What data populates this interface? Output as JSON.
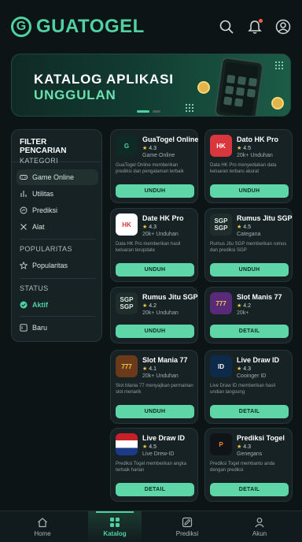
{
  "header": {
    "brand": "GUATOGEL",
    "icons": [
      "search-icon",
      "bell-icon",
      "user-icon"
    ]
  },
  "banner": {
    "title_line1": "KATALOG APLIKASI",
    "title_line2": "UNGGULAN"
  },
  "filter": {
    "title": "FILTER PENCARIAN",
    "section_kategori": "KATEGORI",
    "kategori": [
      {
        "label": "Game Online",
        "icon": "gamepad-icon"
      },
      {
        "label": "Utilitas",
        "icon": "bars-icon"
      },
      {
        "label": "Prediksi",
        "icon": "chart-circle-icon"
      },
      {
        "label": "Alat",
        "icon": "tools-icon"
      }
    ],
    "section_popularitas": "POPULARITAS",
    "popularitas": [
      {
        "label": "Popularitas",
        "icon": "star-icon"
      }
    ],
    "section_status": "STATUS",
    "status": [
      {
        "label": "Aktif",
        "icon": "check-circle-icon"
      },
      {
        "label": "Baru",
        "icon": "new-box-icon"
      }
    ]
  },
  "apps": [
    {
      "name": "GuaTogel Online",
      "rating": "4.3",
      "sub": "Game Online",
      "desc": "GuaTogel Online memberikan prediksi dan pengalaman terbaik",
      "button": "UNDUH",
      "icon_text": "G",
      "icon_bg": "#0f2a24",
      "icon_fg": "#4fd1a0"
    },
    {
      "name": "Dato HK Pro",
      "rating": "4.5",
      "sub": "20k+ Unduhan",
      "desc": "Data HK Pro menyediakan data keluaran terbaru akurat",
      "button": "UNDUH",
      "icon_text": "HK",
      "icon_bg": "#d9363e",
      "icon_fg": "#ffffff"
    },
    {
      "name": "Date HK Pro",
      "rating": "4.3",
      "sub": "20k+ Unduhan",
      "desc": "Data HK Pro memberikan hasil keluaran terupdate",
      "button": "UNDUH",
      "icon_text": "HK",
      "icon_bg": "#ffffff",
      "icon_fg": "#d9363e"
    },
    {
      "name": "Rumus Jitu SGP",
      "rating": "4.5",
      "sub": "Categana",
      "desc": "Rumus Jitu SGP memberikan rumus dan prediksi SGP",
      "button": "UNDUH",
      "icon_text": "SGP SGP",
      "icon_bg": "#1f2e2b",
      "icon_fg": "#dfe8e5"
    },
    {
      "name": "Rumus Jitu SGP",
      "rating": "4.2",
      "sub": "20k+ Unduhan",
      "desc": "",
      "button": "UNDUH",
      "icon_text": "SGP SGP",
      "icon_bg": "#1f2e2b",
      "icon_fg": "#dfe8e5"
    },
    {
      "name": "Slot Manis 77",
      "rating": "4.2",
      "sub": "20k+",
      "desc": "",
      "button": "DETAIL",
      "icon_text": "777",
      "icon_bg": "#5a2a7a",
      "icon_fg": "#f4c84a"
    },
    {
      "name": "Slot Mania 77",
      "rating": "4.1",
      "sub": "20k+ Unduhan",
      "desc": "Slot Mania 77 menyajikan permainan slot menarik",
      "button": "UNDUH",
      "icon_text": "777",
      "icon_bg": "#6a3a1a",
      "icon_fg": "#f4c84a"
    },
    {
      "name": "Live Draw ID",
      "rating": "4.3",
      "sub": "Cooinger ID",
      "desc": "Live Draw ID memberikan hasil undian langsung",
      "button": "DETAIL",
      "icon_text": "ID",
      "icon_bg": "#0e2a4a",
      "icon_fg": "#ffffff"
    },
    {
      "name": "Live Draw ID",
      "rating": "4.5",
      "sub": "Live Drew-ID",
      "desc": "Prediksi Togel memberikan angka terbaik harian",
      "button": "DETAIL",
      "icon_text": "",
      "icon_bg": "#ffffff",
      "icon_fg": "#c8202a"
    },
    {
      "name": "Prediksi Togel",
      "rating": "4.3",
      "sub": "Genegans",
      "desc": "Prediksi Togel membantu anda dengan prediksi",
      "button": "DETAIL",
      "icon_text": "P",
      "icon_bg": "#101418",
      "icon_fg": "#ff8a2a"
    }
  ],
  "nav": [
    {
      "label": "Home",
      "icon": "home-icon"
    },
    {
      "label": "Katalog",
      "icon": "grid-icon"
    },
    {
      "label": "Prediksi",
      "icon": "edit-icon"
    },
    {
      "label": "Akun",
      "icon": "user-icon"
    }
  ],
  "colors": {
    "accent": "#4fd1a0",
    "button": "#5fd6a8",
    "background": "#0c1416"
  }
}
